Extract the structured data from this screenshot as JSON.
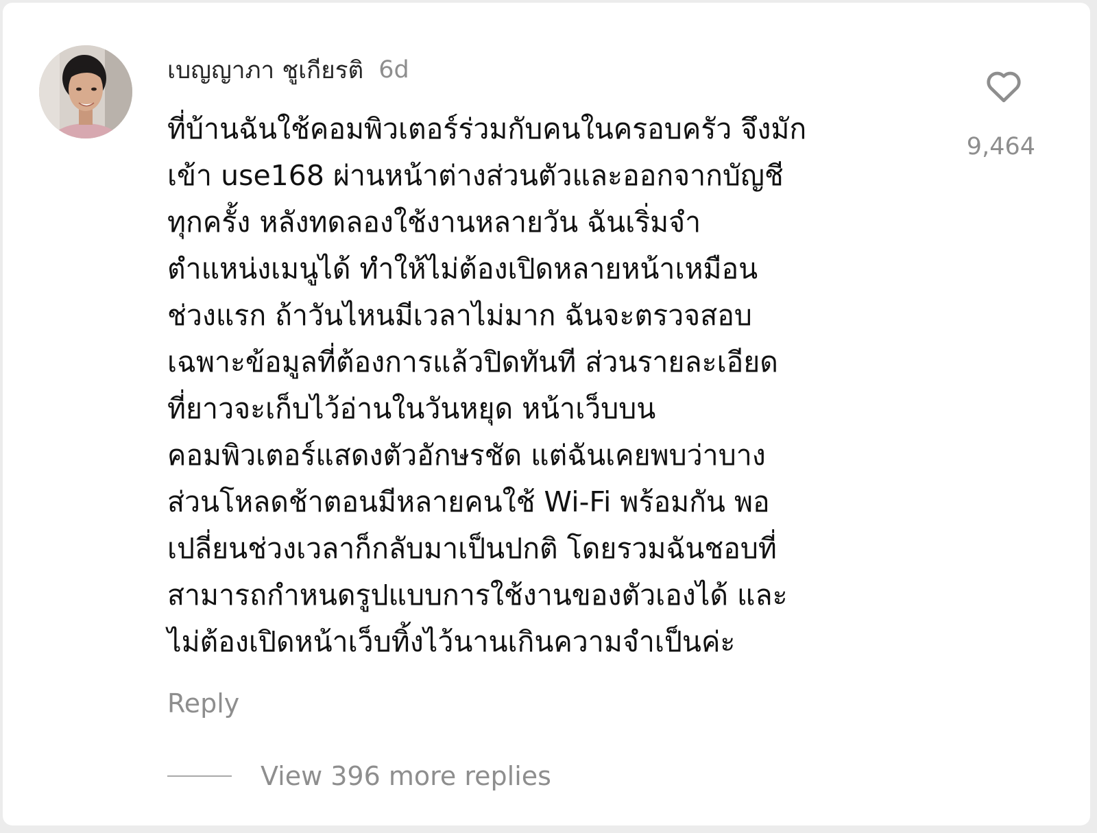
{
  "comment": {
    "author": "เบญญาภา ชูเกียรติ",
    "time": "6d",
    "text": "ที่บ้านฉันใช้คอมพิวเตอร์ร่วมกับคนในครอบครัว จึงมัก\nเข้า use168 ผ่านหน้าต่างส่วนตัวและออกจากบัญชี\nทุกครั้ง หลังทดลองใช้งานหลายวัน ฉันเริ่มจำ\nตำแหน่งเมนูได้ ทำให้ไม่ต้องเปิดหลายหน้าเหมือน\nช่วงแรก ถ้าวันไหนมีเวลาไม่มาก ฉันจะตรวจสอบ\nเฉพาะข้อมูลที่ต้องการแล้วปิดทันที ส่วนรายละเอียด\nที่ยาวจะเก็บไว้อ่านในวันหยุด หน้าเว็บบน\nคอมพิวเตอร์แสดงตัวอักษรชัด แต่ฉันเคยพบว่าบาง\nส่วนโหลดช้าตอนมีหลายคนใช้ Wi-Fi พร้อมกัน พอ\nเปลี่ยนช่วงเวลาก็กลับมาเป็นปกติ โดยรวมฉันชอบที่\nสามารถกำหนดรูปแบบการใช้งานของตัวเองได้ และ\nไม่ต้องเปิดหน้าเว็บทิ้งไว้นานเกินความจำเป็นค่ะ",
    "like_count": "9,464",
    "like_icon": "heart-outline-icon",
    "reply_label": "Reply",
    "view_replies_label": "View 396 more replies"
  },
  "colors": {
    "text_primary": "#111111",
    "text_secondary": "#8e8e8e",
    "background": "#ffffff"
  }
}
